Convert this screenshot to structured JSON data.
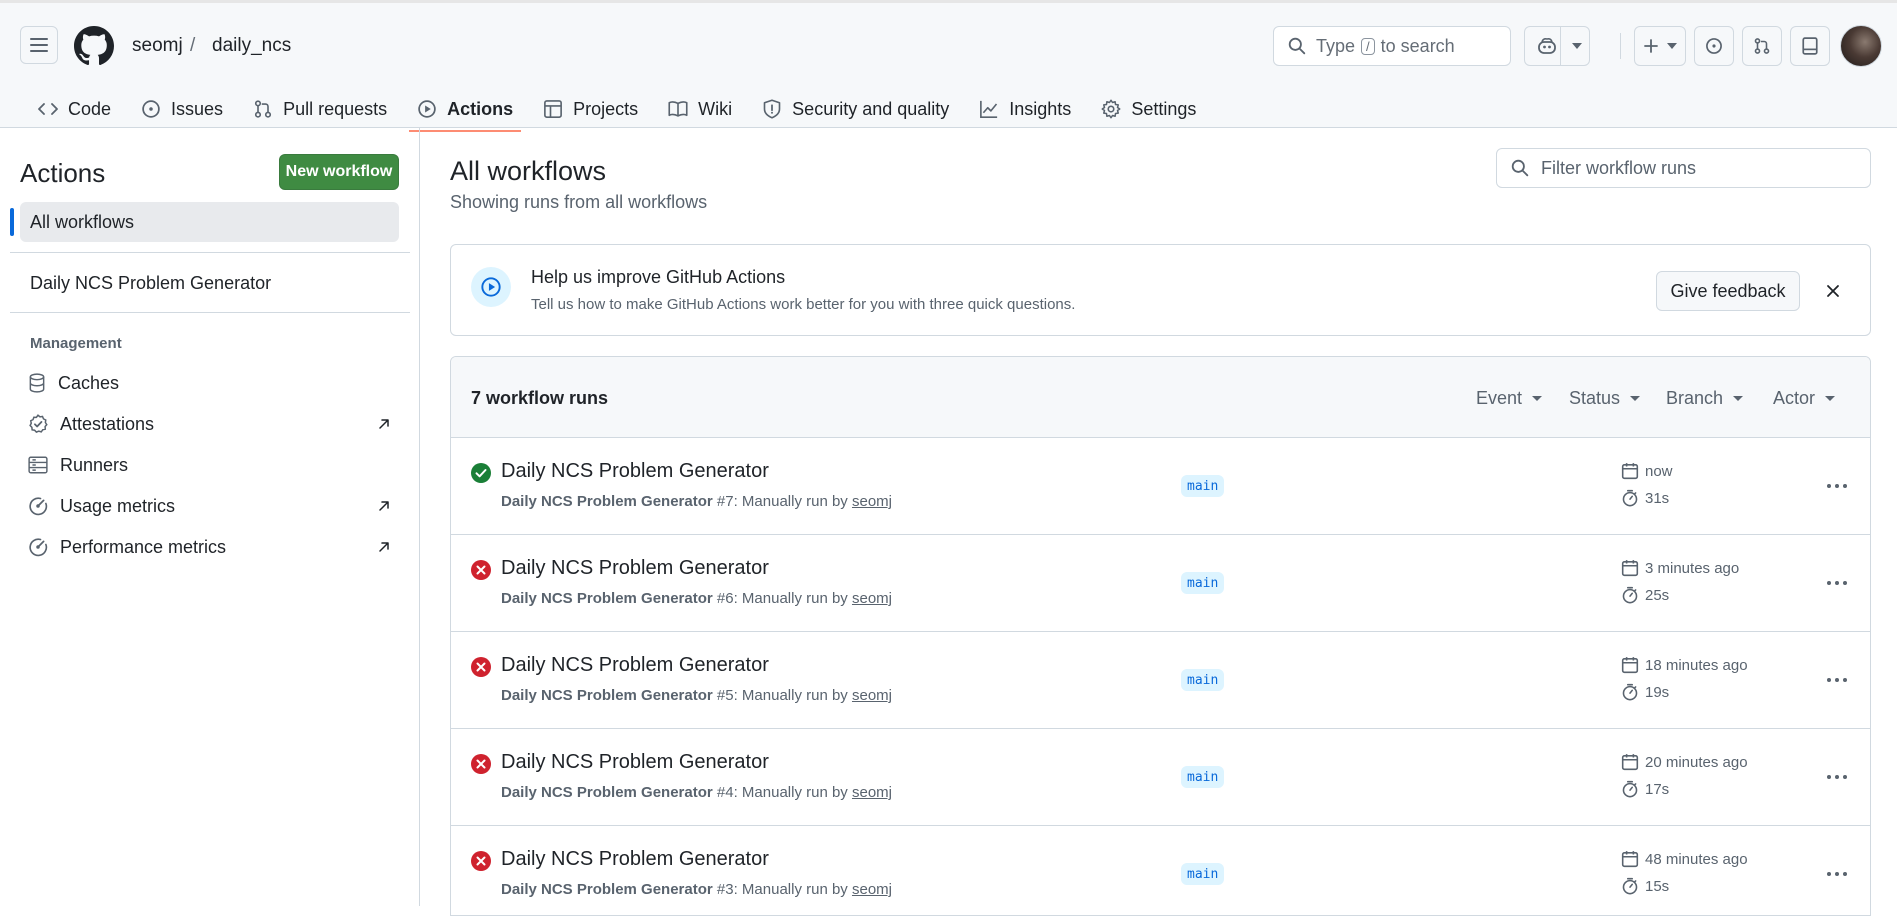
{
  "header": {
    "owner": "seomj",
    "separator": "/",
    "repo": "daily_ncs",
    "search_prefix": "Type",
    "search_key": "/",
    "search_suffix": "to search"
  },
  "tabs": [
    {
      "label": "Code",
      "icon": "code-icon"
    },
    {
      "label": "Issues",
      "icon": "issue-icon"
    },
    {
      "label": "Pull requests",
      "icon": "pull-request-icon"
    },
    {
      "label": "Actions",
      "icon": "play-icon",
      "active": true
    },
    {
      "label": "Projects",
      "icon": "table-icon"
    },
    {
      "label": "Wiki",
      "icon": "book-icon"
    },
    {
      "label": "Security and quality",
      "icon": "shield-icon"
    },
    {
      "label": "Insights",
      "icon": "graph-icon"
    },
    {
      "label": "Settings",
      "icon": "gear-icon"
    }
  ],
  "sidebar": {
    "title": "Actions",
    "new_workflow": "New workflow",
    "all_workflows": "All workflows",
    "workflow": "Daily NCS Problem Generator",
    "management_label": "Management",
    "management": [
      {
        "label": "Caches",
        "icon": "database-icon",
        "external": false
      },
      {
        "label": "Attestations",
        "icon": "verified-icon",
        "external": true
      },
      {
        "label": "Runners",
        "icon": "server-icon",
        "external": false
      },
      {
        "label": "Usage metrics",
        "icon": "meter-icon",
        "external": true
      },
      {
        "label": "Performance metrics",
        "icon": "meter-icon",
        "external": true
      }
    ]
  },
  "main": {
    "title": "All workflows",
    "subtitle": "Showing runs from all workflows",
    "filter_placeholder": "Filter workflow runs"
  },
  "banner": {
    "title": "Help us improve GitHub Actions",
    "text": "Tell us how to make GitHub Actions work better for you with three quick questions.",
    "button": "Give feedback"
  },
  "runs": {
    "count_label": "7 workflow runs",
    "filters": [
      "Event",
      "Status",
      "Branch",
      "Actor"
    ],
    "items": [
      {
        "title": "Daily NCS Problem Generator",
        "workflow": "Daily NCS Problem Generator",
        "meta": " #7: Manually run by ",
        "user": "seomj",
        "branch": "main",
        "when": "now",
        "duration": "31s",
        "status": "success"
      },
      {
        "title": "Daily NCS Problem Generator",
        "workflow": "Daily NCS Problem Generator",
        "meta": " #6: Manually run by ",
        "user": "seomj",
        "branch": "main",
        "when": "3 minutes ago",
        "duration": "25s",
        "status": "failure"
      },
      {
        "title": "Daily NCS Problem Generator",
        "workflow": "Daily NCS Problem Generator",
        "meta": " #5: Manually run by ",
        "user": "seomj",
        "branch": "main",
        "when": "18 minutes ago",
        "duration": "19s",
        "status": "failure"
      },
      {
        "title": "Daily NCS Problem Generator",
        "workflow": "Daily NCS Problem Generator",
        "meta": " #4: Manually run by ",
        "user": "seomj",
        "branch": "main",
        "when": "20 minutes ago",
        "duration": "17s",
        "status": "failure"
      },
      {
        "title": "Daily NCS Problem Generator",
        "workflow": "Daily NCS Problem Generator",
        "meta": " #3: Manually run by ",
        "user": "seomj",
        "branch": "main",
        "when": "48 minutes ago",
        "duration": "15s",
        "status": "failure"
      }
    ]
  },
  "colors": {
    "success": "#1a7f37",
    "failure": "#cf222e",
    "accent": "#0969da",
    "primary_button": "#3f8b42"
  }
}
